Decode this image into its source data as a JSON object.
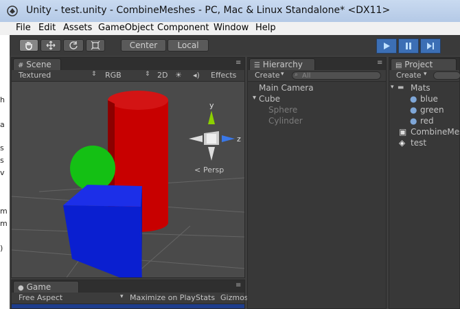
{
  "window": {
    "title": "Unity - test.unity - CombineMeshes - PC, Mac & Linux Standalone* <DX11>"
  },
  "menu": [
    "File",
    "Edit",
    "Assets",
    "GameObject",
    "Component",
    "Window",
    "Help"
  ],
  "left_strip": [
    "h",
    "a",
    "s",
    "s",
    "v",
    "m",
    "m",
    ")"
  ],
  "toolbar": {
    "pivot_mode": "Center",
    "pivot_space": "Local"
  },
  "scene": {
    "tab_label": "Scene",
    "render_mode": "Textured",
    "color_mode": "RGB",
    "view_2d": "2D",
    "effects": "Effects",
    "gizmo_y": "y",
    "gizmo_z": "z",
    "persp_label": "Persp"
  },
  "game": {
    "tab_label": "Game",
    "aspect": "Free Aspect",
    "maximize": "Maximize on Play",
    "stats": "Stats",
    "gizmos": "Gizmos"
  },
  "hierarchy": {
    "tab_label": "Hierarchy",
    "create_label": "Create",
    "search_placeholder": "All",
    "items": [
      {
        "label": "Main Camera"
      },
      {
        "label": "Cube"
      },
      {
        "label": "Sphere"
      },
      {
        "label": "Cylinder"
      }
    ]
  },
  "project": {
    "tab_label": "Project",
    "create_label": "Create",
    "folder": "Mats",
    "materials": [
      "blue",
      "green",
      "red"
    ],
    "assets": [
      "CombineMes",
      "test"
    ]
  },
  "colors": {
    "cylinder": "#c40000",
    "sphere": "#14b814",
    "cube": "#0b2fd6",
    "play_accent": "#3c6fb5"
  }
}
